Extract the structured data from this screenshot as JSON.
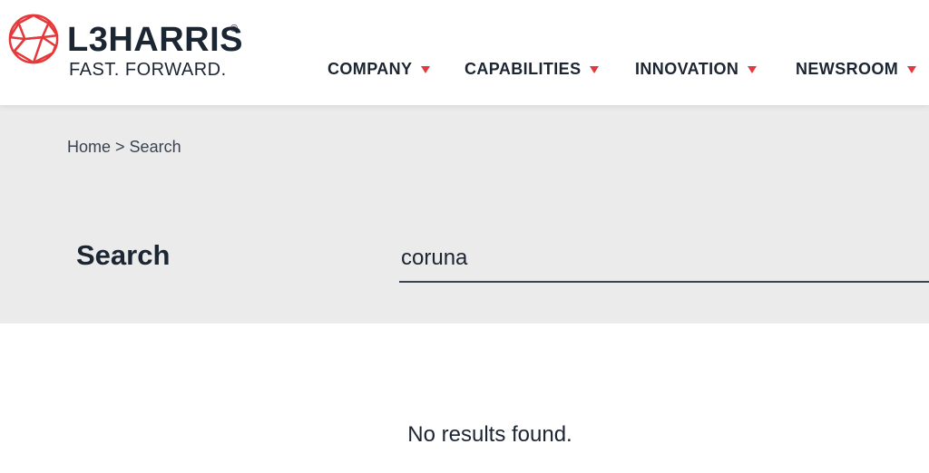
{
  "brand": {
    "name": "L3HARRIS",
    "registered": "®",
    "tagline": "FAST. FORWARD.",
    "accent_color": "#e5383b"
  },
  "nav": {
    "items": [
      {
        "label": "COMPANY",
        "icon": "caret-down-icon"
      },
      {
        "label": "CAPABILITIES",
        "icon": "caret-down-icon"
      },
      {
        "label": "INNOVATION",
        "icon": "caret-down-icon"
      },
      {
        "label": "NEWSROOM",
        "icon": "caret-down-icon"
      }
    ]
  },
  "breadcrumb": {
    "home": "Home",
    "separator": ">",
    "current": "Search"
  },
  "search": {
    "heading": "Search",
    "value": "coruna"
  },
  "results": {
    "empty_message": "No results found."
  }
}
